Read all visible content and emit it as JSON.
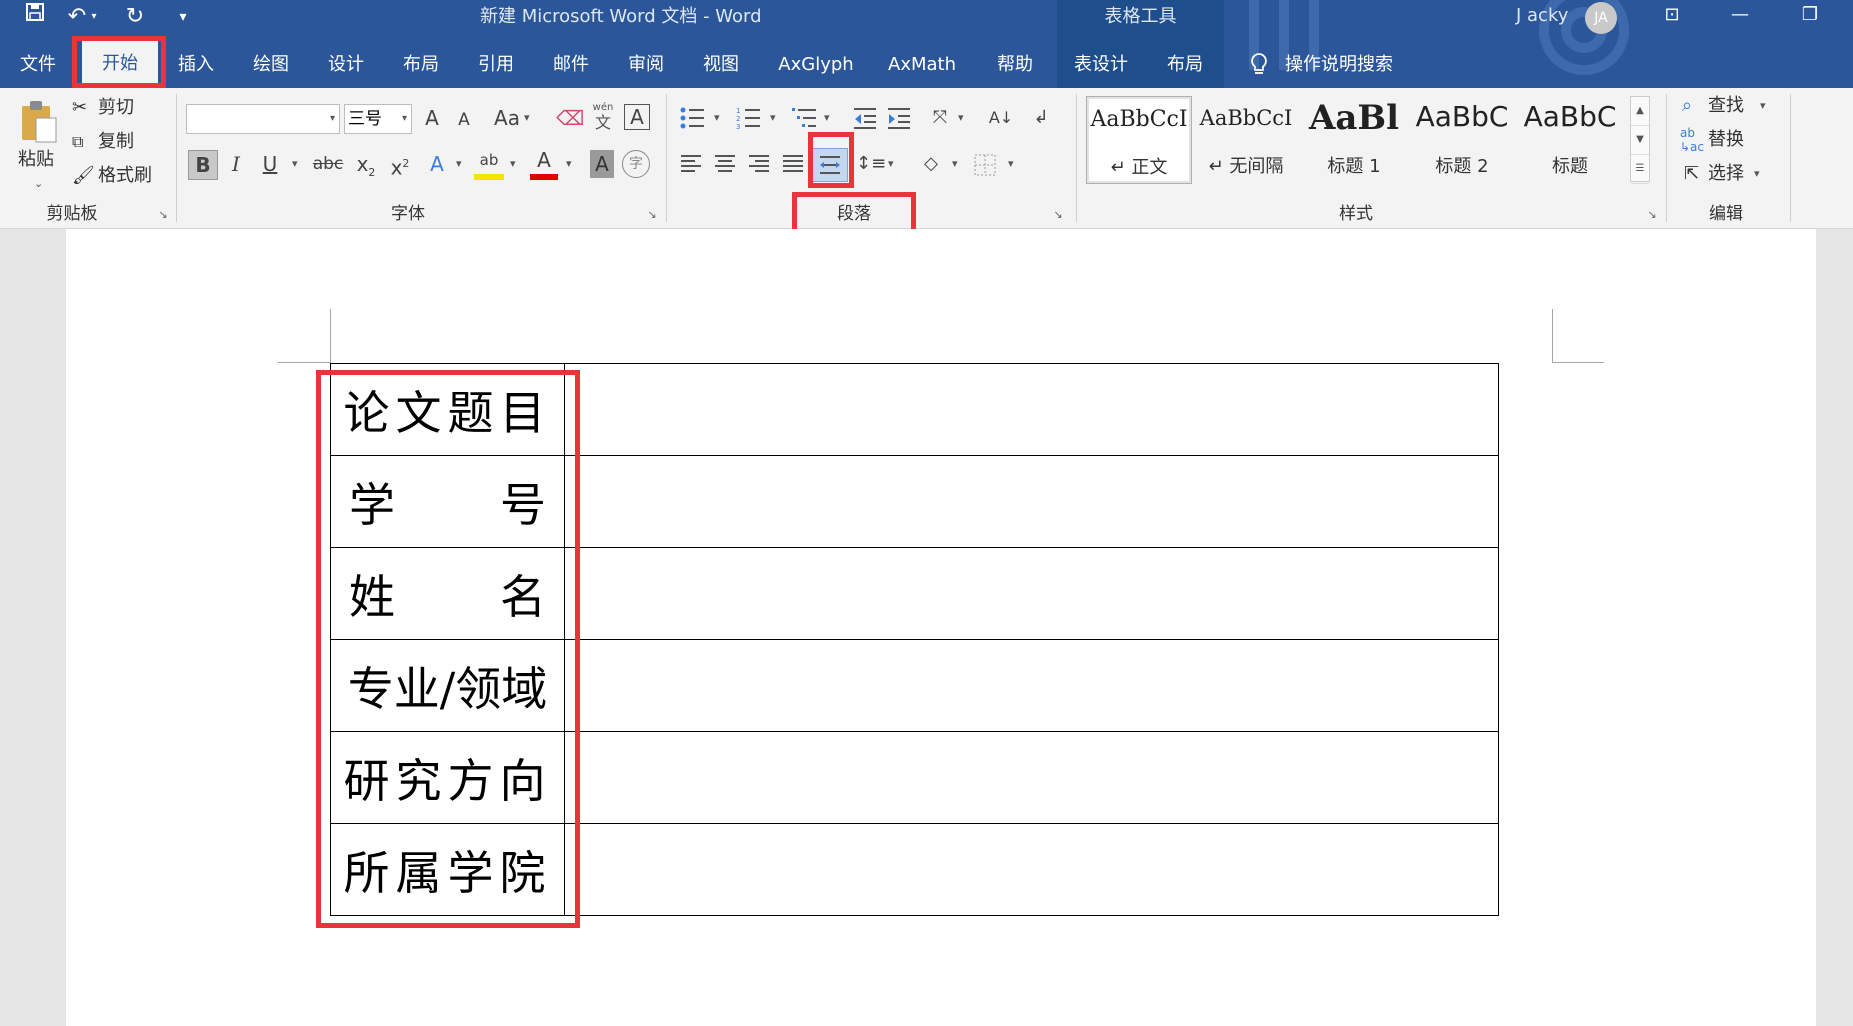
{
  "window": {
    "title": "新建 Microsoft Word 文档  -  Word",
    "contextual_tools": "表格工具",
    "user_name": "J acky",
    "user_initials": "JA"
  },
  "quick_access": {
    "save_icon": "save-icon",
    "undo_icon": "undo-icon",
    "redo_icon": "redo-icon",
    "customize_icon": "customize-qat-icon"
  },
  "tabs": [
    "文件",
    "开始",
    "插入",
    "绘图",
    "设计",
    "布局",
    "引用",
    "邮件",
    "审阅",
    "视图",
    "AxGlyph",
    "AxMath",
    "帮助",
    "表设计",
    "布局"
  ],
  "active_tab": "开始",
  "tell_me": "操作说明搜索",
  "clipboard": {
    "paste": "粘贴",
    "cut": "剪切",
    "copy": "复制",
    "format_painter": "格式刷",
    "group_label": "剪贴板"
  },
  "font": {
    "font_name": "",
    "font_size": "三号",
    "grow": "A",
    "shrink": "A",
    "change_case": "Aa",
    "phonetic_top": "wén",
    "phonetic_bottom": "文",
    "border_char": "A",
    "bold": "B",
    "italic": "I",
    "underline": "U",
    "strike": "abc",
    "subscript_base": "x",
    "subscript": "2",
    "superscript_base": "x",
    "superscript": "2",
    "effects": "A",
    "highlight": "ab",
    "font_color": "A",
    "shading": "A",
    "enclose": "字",
    "group_label": "字体"
  },
  "paragraph": {
    "group_label": "段落"
  },
  "styles": {
    "items": [
      {
        "sample": "AaBbCcI",
        "name": "↵ 正文"
      },
      {
        "sample": "AaBbCcI",
        "name": "↵ 无间隔"
      },
      {
        "sample": "AaBl",
        "name": "标题 1"
      },
      {
        "sample": "AaBbC",
        "name": "标题 2"
      },
      {
        "sample": "AaBbC",
        "name": "标题"
      }
    ],
    "group_label": "样式"
  },
  "editing": {
    "find": "查找",
    "replace": "替换",
    "select": "选择",
    "group_label": "编辑"
  },
  "document": {
    "rows": [
      {
        "label": "论文题目",
        "split": false,
        "left": "",
        "right": "",
        "value": ""
      },
      {
        "label": "",
        "split": true,
        "left": "学",
        "right": "号",
        "value": ""
      },
      {
        "label": "",
        "split": true,
        "left": "姓",
        "right": "名",
        "value": ""
      },
      {
        "label": "专业/领域",
        "split": false,
        "left": "",
        "right": "",
        "value": ""
      },
      {
        "label": "研究方向",
        "split": false,
        "left": "",
        "right": "",
        "value": ""
      },
      {
        "label": "所属学院",
        "split": false,
        "left": "",
        "right": "",
        "value": ""
      }
    ]
  },
  "highlight_color": "#e8343a",
  "accent_color": "#2b579a"
}
